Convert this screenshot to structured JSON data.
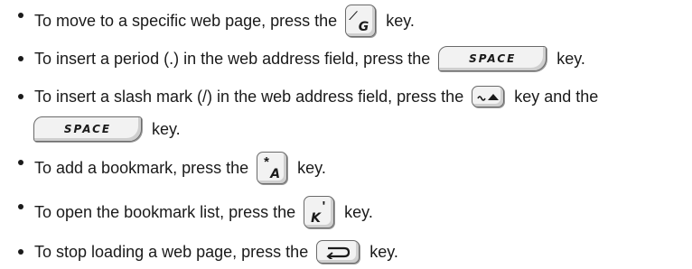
{
  "items": [
    {
      "before": "To move to a specific web page, press the",
      "key1": {
        "top": "⁄",
        "bottom": "G",
        "icon": "slash-g-key-icon"
      },
      "after": "key."
    },
    {
      "before": "To insert a period (.) in the web address field, press the",
      "key1": {
        "label": "SPACE",
        "icon": "space-key-icon"
      },
      "after": "key."
    },
    {
      "before": "To insert a slash mark (/) in the web address field, press the",
      "key1": {
        "icon": "alt-key-icon"
      },
      "middle": "key and the",
      "key2": {
        "label": "SPACE",
        "icon": "space-key-icon"
      },
      "after": "key."
    },
    {
      "before": "To add a bookmark, press the",
      "key1": {
        "top": "*",
        "bottom": "A",
        "icon": "asterisk-a-key-icon"
      },
      "after": "key."
    },
    {
      "before": "To open the bookmark list, press the",
      "key1": {
        "top": "'",
        "bottom": "K",
        "icon": "apostrophe-k-key-icon"
      },
      "after": "key."
    },
    {
      "before": "To stop loading a web page, press the",
      "key1": {
        "icon": "escape-key-icon"
      },
      "after": "key."
    }
  ]
}
